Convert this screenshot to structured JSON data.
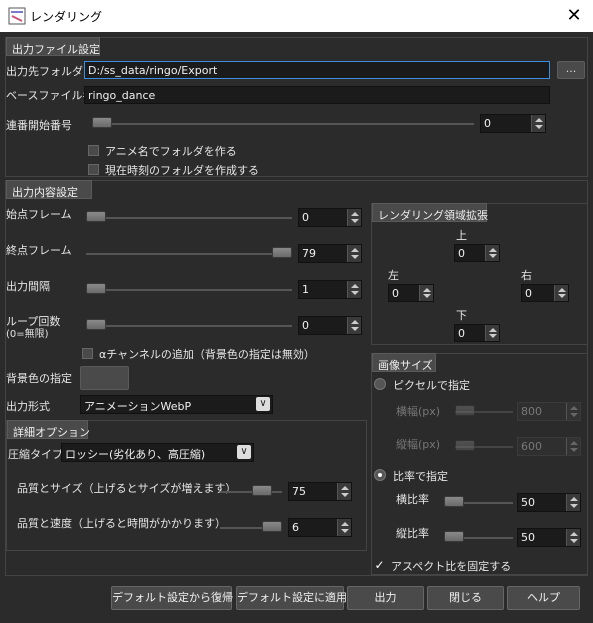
{
  "window": {
    "title": "レンダリング",
    "close_label": "✕",
    "app_icon": "render-app-icon"
  },
  "output_file": {
    "header": "出力ファイル設定",
    "folder_label": "出力先フォルダ",
    "folder_value": "D:/ss_data/ringo/Export",
    "browse_label": "...",
    "basename_label": "ベースファイル名",
    "basename_value": "ringo_dance",
    "seq_label": "連番開始番号",
    "seq_value": "0",
    "chk_anime_folder": "アニメ名でフォルダを作る",
    "chk_time_folder": "現在時刻のフォルダを作成する"
  },
  "output_content": {
    "header": "出力内容設定",
    "start_label": "始点フレーム",
    "start_value": "0",
    "end_label": "終点フレーム",
    "end_value": "79",
    "interval_label": "出力間隔",
    "interval_value": "1",
    "loop_label_1": "ループ回数",
    "loop_label_2": "(0=無限)",
    "loop_value": "0",
    "alpha_label": "αチャンネルの追加（背景色の指定は無効）",
    "bg_label": "背景色の指定",
    "format_label": "出力形式",
    "format_value": "アニメーションWebP"
  },
  "details": {
    "header": "詳細オプション",
    "compress_label": "圧縮タイプ",
    "compress_value": "ロッシー(劣化あり、高圧縮)",
    "quality_size_label": "品質とサイズ（上げるとサイズが増えます）",
    "quality_size_value": "75",
    "quality_speed_label": "品質と速度（上げると時間がかかります）",
    "quality_speed_value": "6"
  },
  "render_area": {
    "header": "レンダリング領域拡張",
    "top_label": "上",
    "top_value": "0",
    "left_label": "左",
    "left_value": "0",
    "right_label": "右",
    "right_value": "0",
    "bottom_label": "下",
    "bottom_value": "0"
  },
  "image_size": {
    "header": "画像サイズ",
    "pixel_radio": "ピクセルで指定",
    "width_px_label": "横幅(px)",
    "width_px_value": "800",
    "height_px_label": "縦幅(px)",
    "height_px_value": "600",
    "ratio_radio": "比率で指定",
    "width_ratio_label": "横比率",
    "width_ratio_value": "50",
    "height_ratio_label": "縦比率",
    "height_ratio_value": "50",
    "aspect_label": "アスペクト比を固定する",
    "aspect_check": "✓"
  },
  "buttons": {
    "restore_default": "デフォルト設定から復帰",
    "apply_default": "デフォルト設定に適用",
    "output": "出力",
    "close": "閉じる",
    "help": "ヘルプ"
  },
  "colors": {
    "background": "#2b2b2b",
    "field": "#1b1b1b",
    "focus_border": "#3d8ee0"
  }
}
